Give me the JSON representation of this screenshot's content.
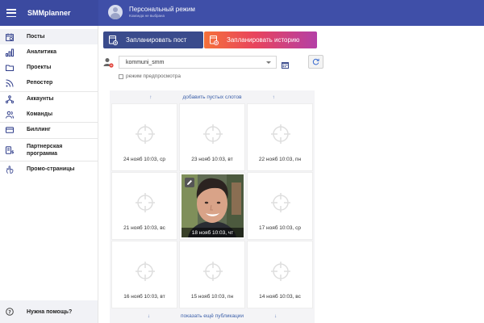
{
  "app": {
    "brand": "SMMplanner"
  },
  "profile": {
    "title": "Персональный режим",
    "subtitle": "Команда не выбрана"
  },
  "sidebar": {
    "items": [
      {
        "label": "Посты",
        "icon": "calendar-icon"
      },
      {
        "label": "Аналитика",
        "icon": "bar-chart-icon"
      },
      {
        "label": "Проекты",
        "icon": "folder-icon"
      },
      {
        "label": "Репостер",
        "icon": "rss-icon"
      },
      {
        "label": "Аккаунты",
        "icon": "network-icon"
      },
      {
        "label": "Команды",
        "icon": "users-icon"
      },
      {
        "label": "Биллинг",
        "icon": "card-icon"
      },
      {
        "label": "Партнерская программа",
        "icon": "money-icon"
      },
      {
        "label": "Промо-страницы",
        "icon": "hand-icon"
      }
    ],
    "help": "Нужна помощь?"
  },
  "toolbar": {
    "schedule_post": "Запланировать пост",
    "schedule_story": "Запланировать историю"
  },
  "account": {
    "selected": "kommuni_smm"
  },
  "preview_mode": {
    "label": "режим предпросмотра",
    "checked": false
  },
  "grid": {
    "add_slots": "добавить пустых слотов",
    "show_more": "показать ещё публикации",
    "cells": [
      {
        "date": "24 нояб 10:03, ср",
        "has_photo": false
      },
      {
        "date": "23 нояб 10:03, вт",
        "has_photo": false
      },
      {
        "date": "22 нояб 10:03, пн",
        "has_photo": false
      },
      {
        "date": "21 нояб 10:03, вс",
        "has_photo": false
      },
      {
        "date": "18 нояб 10:03, чт",
        "has_photo": true
      },
      {
        "date": "17 нояб 10:03, ср",
        "has_photo": false
      },
      {
        "date": "16 нояб 10:03, вт",
        "has_photo": false
      },
      {
        "date": "15 нояб 10:03, пн",
        "has_photo": false
      },
      {
        "date": "14 нояб 10:03, вс",
        "has_photo": false
      }
    ]
  },
  "colors": {
    "header": "#3f4fa8",
    "primary_button": "#3a4b8c",
    "story_gradient_start": "#f5713a",
    "story_gradient_end": "#b43fa6",
    "link": "#3b5fa9"
  }
}
